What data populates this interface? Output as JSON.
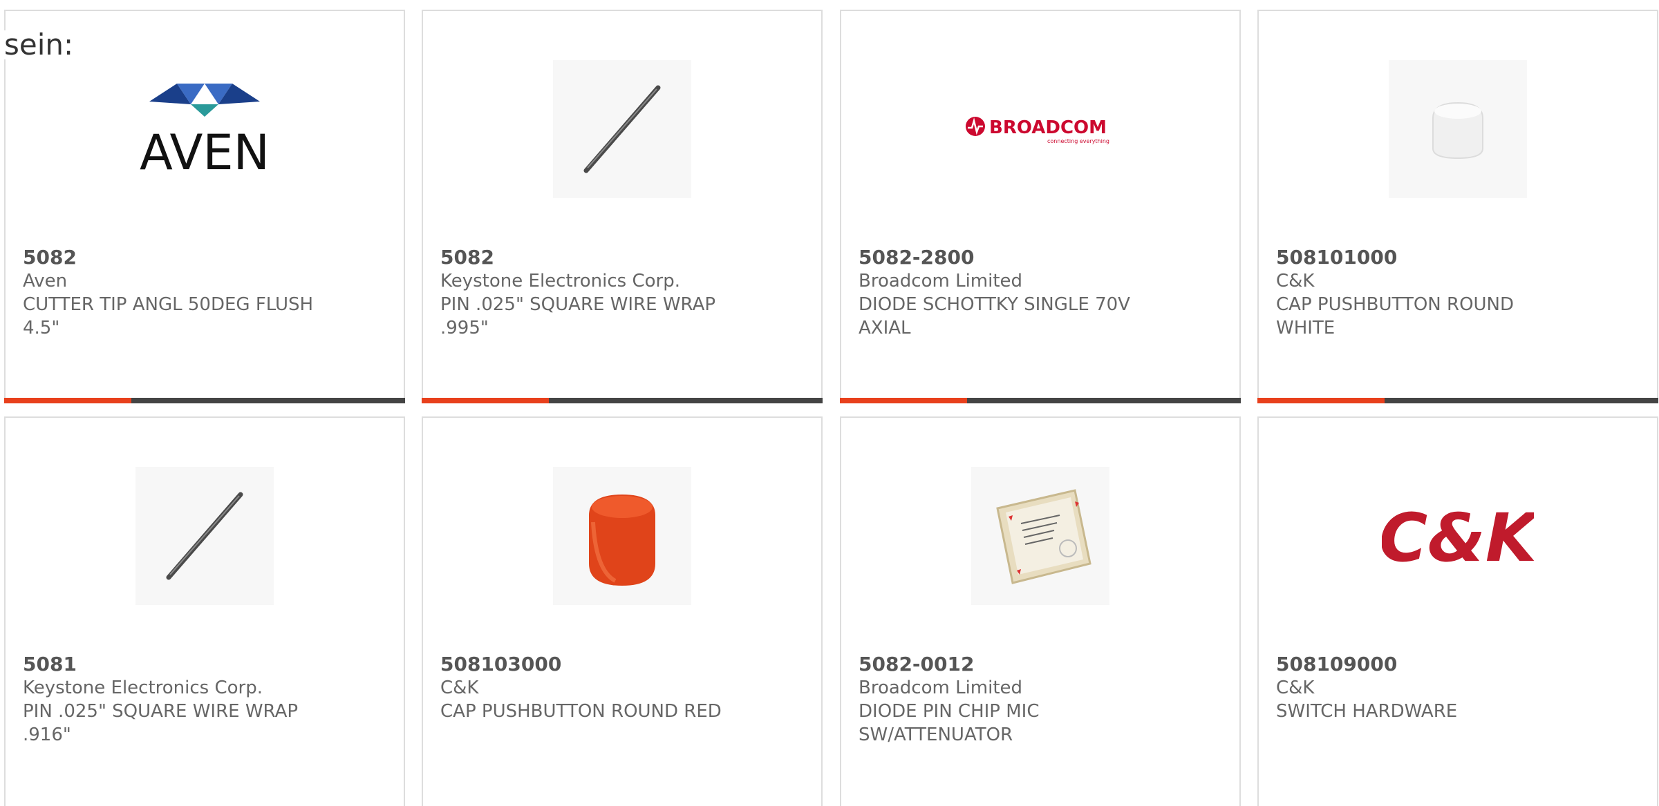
{
  "prefix_text": "sein:",
  "colors": {
    "accent": "#e8401c",
    "bar": "#444444",
    "border": "#dddddd",
    "text": "#666666"
  },
  "products": [
    {
      "part_number": "5082",
      "manufacturer": "Aven",
      "desc_line1": "CUTTER TIP ANGL 50DEG FLUSH",
      "desc_line2": "4.5\"",
      "image": "aven-logo",
      "logo_text": "AVEN"
    },
    {
      "part_number": "5082",
      "manufacturer": "Keystone Electronics Corp.",
      "desc_line1": "PIN .025\" SQUARE WIRE WRAP",
      "desc_line2": ".995\"",
      "image": "wire-wrap-pin"
    },
    {
      "part_number": "5082-2800",
      "manufacturer": "Broadcom Limited",
      "desc_line1": "DIODE SCHOTTKY SINGLE 70V",
      "desc_line2": "AXIAL",
      "image": "broadcom-logo",
      "logo_text": "BROADCOM",
      "logo_tagline": "connecting everything"
    },
    {
      "part_number": "508101000",
      "manufacturer": "C&K",
      "desc_line1": "CAP PUSHBUTTON ROUND",
      "desc_line2": "WHITE",
      "image": "white-cap"
    },
    {
      "part_number": "5081",
      "manufacturer": "Keystone Electronics Corp.",
      "desc_line1": "PIN .025\" SQUARE WIRE WRAP",
      "desc_line2": ".916\"",
      "image": "wire-wrap-pin"
    },
    {
      "part_number": "508103000",
      "manufacturer": "C&K",
      "desc_line1": "CAP PUSHBUTTON ROUND RED",
      "desc_line2": "",
      "image": "red-cap"
    },
    {
      "part_number": "5082-0012",
      "manufacturer": "Broadcom Limited",
      "desc_line1": "DIODE PIN CHIP MIC",
      "desc_line2": "SW/ATTENUATOR",
      "image": "chip-package"
    },
    {
      "part_number": "508109000",
      "manufacturer": "C&K",
      "desc_line1": "SWITCH HARDWARE",
      "desc_line2": "",
      "image": "ck-logo",
      "logo_text": "C&K"
    }
  ]
}
